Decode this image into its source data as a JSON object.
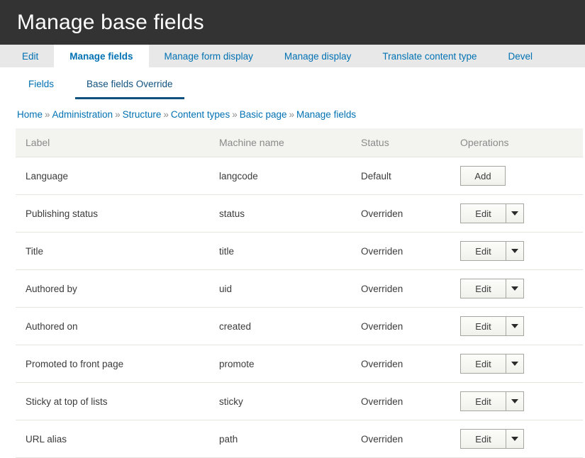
{
  "header": {
    "title": "Manage base fields"
  },
  "primary_tabs": [
    {
      "label": "Edit",
      "active": false
    },
    {
      "label": "Manage fields",
      "active": true
    },
    {
      "label": "Manage form display",
      "active": false
    },
    {
      "label": "Manage display",
      "active": false
    },
    {
      "label": "Translate content type",
      "active": false
    },
    {
      "label": "Devel",
      "active": false
    }
  ],
  "secondary_tabs": [
    {
      "label": "Fields",
      "active": false
    },
    {
      "label": "Base fields Override",
      "active": true
    }
  ],
  "breadcrumb": {
    "separator": "»",
    "items": [
      "Home",
      "Administration",
      "Structure",
      "Content types",
      "Basic page",
      "Manage fields"
    ]
  },
  "table": {
    "columns": [
      "Label",
      "Machine name",
      "Status",
      "Operations"
    ],
    "rows": [
      {
        "label": "Language",
        "machine_name": "langcode",
        "status": "Default",
        "operation": "Add",
        "has_dropdown": false
      },
      {
        "label": "Publishing status",
        "machine_name": "status",
        "status": "Overriden",
        "operation": "Edit",
        "has_dropdown": true
      },
      {
        "label": "Title",
        "machine_name": "title",
        "status": "Overriden",
        "operation": "Edit",
        "has_dropdown": true
      },
      {
        "label": "Authored by",
        "machine_name": "uid",
        "status": "Overriden",
        "operation": "Edit",
        "has_dropdown": true
      },
      {
        "label": "Authored on",
        "machine_name": "created",
        "status": "Overriden",
        "operation": "Edit",
        "has_dropdown": true
      },
      {
        "label": "Promoted to front page",
        "machine_name": "promote",
        "status": "Overriden",
        "operation": "Edit",
        "has_dropdown": true
      },
      {
        "label": "Sticky at top of lists",
        "machine_name": "sticky",
        "status": "Overriden",
        "operation": "Edit",
        "has_dropdown": true
      },
      {
        "label": "URL alias",
        "machine_name": "path",
        "status": "Overriden",
        "operation": "Edit",
        "has_dropdown": true
      }
    ]
  },
  "colors": {
    "header_background": "#333333",
    "link": "#0071b3",
    "active_underline": "#10527f",
    "tabbar_background": "#e8e8e8",
    "table_header_background": "#f3f3ef",
    "row_border": "#e6e4df"
  },
  "icons": {
    "dropdown_caret": "chevron-down-icon"
  }
}
